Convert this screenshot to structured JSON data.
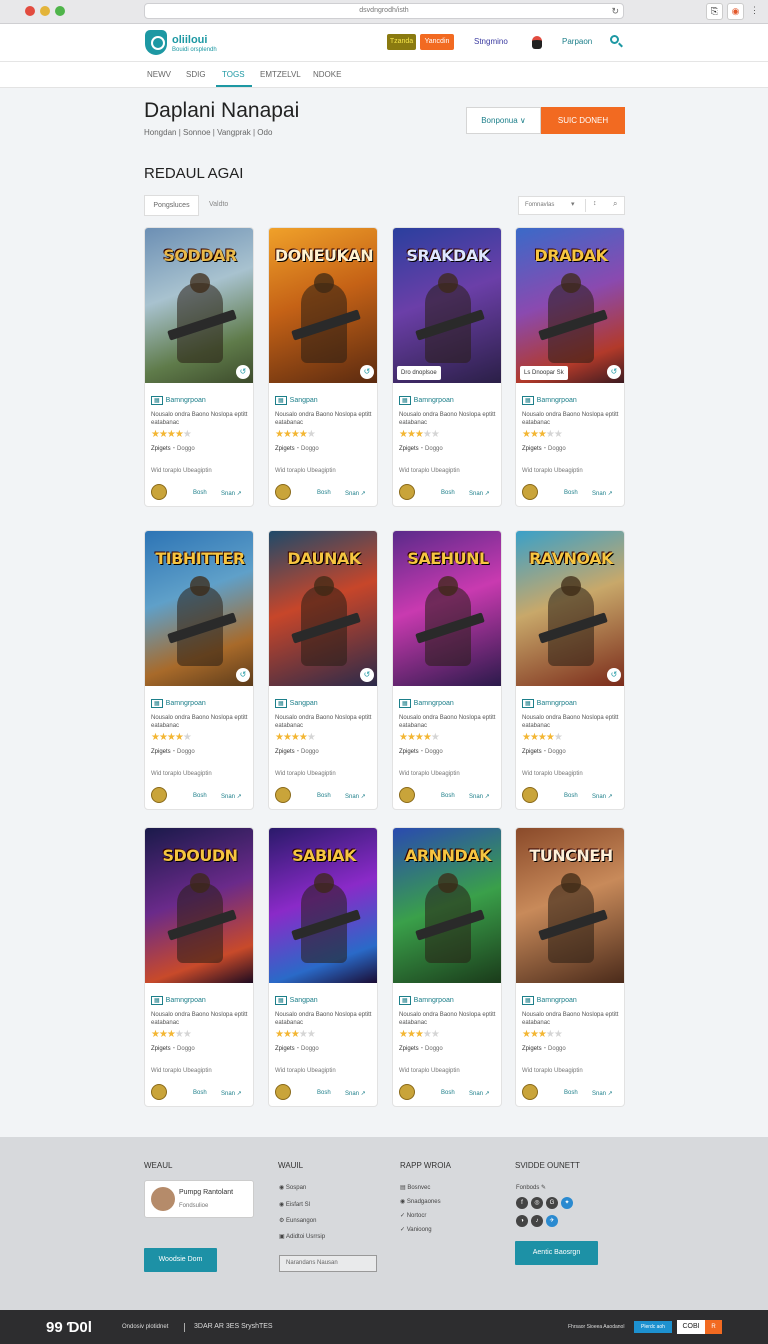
{
  "browser": {
    "url": "dsvdngrodh/isth"
  },
  "header": {
    "logo_title": "oliiloui",
    "logo_sub": "Bouidi orsplendh",
    "btn_a": "Tzanda",
    "btn_b": "Yancdin",
    "link_a": "Stngmino",
    "link_b": "Parpaon"
  },
  "tabs": [
    "NEWV",
    "SDIG",
    "TOGS",
    "EMTZELVL",
    "NDOKE"
  ],
  "page": {
    "title": "Daplani Nanapai",
    "breadcrumb": "Hongdan | Sonnoe | Vangprak | Odo",
    "btn_outline": "Bonponua ∨",
    "btn_primary": "SUIC DONEH",
    "section": "REDAUL AGAI",
    "filter_a": "Pongsluces",
    "filter_b": "Valdto",
    "sort": "Fomnavlas"
  },
  "cards": [
    {
      "title": "SODDAR",
      "caption": "",
      "badge": "↺",
      "tag": "Bamngrpoan",
      "desc": "Nousalo ondra Baono Noslopa eptitt eatabanac",
      "rating": 4,
      "meta": "Zpigets",
      "dl": "Wid toraplo Ubeagiptin",
      "a": "Bosh",
      "b": "Snan ↗",
      "bg": "linear-gradient(160deg,#6c8fb4 0%,#a8c2cf 40%,#5f7b4a 75%,#3c4a2b 100%)",
      "tc": "#e8b84a"
    },
    {
      "title": "DONEUKAN",
      "caption": "",
      "badge": "↺",
      "tag": "Sangpan",
      "desc": "Nousalo ondra Baono Noslopa eptitt eatabanac",
      "rating": 4,
      "meta": "Zpigets",
      "dl": "Wid toraplo Ubeagiptin",
      "a": "Bosh",
      "b": "Snan ↗",
      "bg": "linear-gradient(160deg,#f0a12a 0%,#c56216 45%,#5a2a10 100%)",
      "tc": "#fff2d0"
    },
    {
      "title": "SRAKDAK",
      "caption": "Dro dnoplsoe",
      "badge": "",
      "tag": "Bamngrpoan",
      "desc": "Nousalo ondra Baono Noslopa eptitt eatabanac",
      "rating": 3,
      "meta": "Zpigets",
      "dl": "Wid toraplo Ubeagiptin",
      "a": "Bosh",
      "b": "Snan ↗",
      "bg": "linear-gradient(160deg,#2a3f9e 0%,#6b3fa8 45%,#2a1f46 100%)",
      "tc": "#dfe6ff"
    },
    {
      "title": "DRADAK",
      "caption": "Ls Dnoopar Sk",
      "badge": "↺",
      "tag": "Bamngrpoan",
      "desc": "Nousalo ondra Baono Noslopa eptitt eatabanac",
      "rating": 3,
      "meta": "Zpigets",
      "dl": "Wid toraplo Ubeagiptin",
      "a": "Bosh",
      "b": "Snan ↗",
      "bg": "linear-gradient(160deg,#3a6ac8 0%,#8a4ab0 45%,#b23a2a 80%,#3a1a20 100%)",
      "tc": "#f6c541"
    },
    {
      "title": "TIBHITTER",
      "caption": "",
      "badge": "↺",
      "tag": "Bamngrpoan",
      "desc": "Nousalo ondra Baono Noslopa eptitt eatabanac",
      "rating": 4,
      "meta": "Zpigets",
      "dl": "Wid toraplo Ubeagiptin",
      "a": "Bosh",
      "b": "Snan ↗",
      "bg": "linear-gradient(160deg,#2d74b5 0%,#5fa0c9 40%,#a86a2a 75%,#5a3a1a 100%)",
      "tc": "#f6c541"
    },
    {
      "title": "DAUNAK",
      "caption": "",
      "badge": "↺",
      "tag": "Sangpan",
      "desc": "Nousalo ondra Baono Noslopa eptitt eatabanac",
      "rating": 4,
      "meta": "Zpigets",
      "dl": "Wid toraplo Ubeagiptin",
      "a": "Bosh",
      "b": "Snan ↗",
      "bg": "linear-gradient(160deg,#1f4a6a 0%,#c7462a 45%,#2a2a4a 100%)",
      "tc": "#f6c541"
    },
    {
      "title": "SAEHUNL",
      "caption": "",
      "badge": "",
      "tag": "Bamngrpoan",
      "desc": "Nousalo ondra Baono Noslopa eptitt eatabanac",
      "rating": 4,
      "meta": "Zpigets",
      "dl": "Wid toraplo Ubeagiptin",
      "a": "Bosh",
      "b": "Snan ↗",
      "bg": "linear-gradient(160deg,#5a2a8a 0%,#c93ab0 45%,#2a1a4a 100%)",
      "tc": "#f6c541"
    },
    {
      "title": "RAVNOAK",
      "caption": "",
      "badge": "↺",
      "tag": "Bamngrpoan",
      "desc": "Nousalo ondra Baono Noslopa eptitt eatabanac",
      "rating": 4,
      "meta": "Zpigets",
      "dl": "Wid toraplo Ubeagiptin",
      "a": "Bosh",
      "b": "Snan ↗",
      "bg": "linear-gradient(160deg,#3aa0c8 0%,#c8a86a 45%,#7a2a1a 100%)",
      "tc": "#f6c541"
    },
    {
      "title": "SDOUDN",
      "caption": "",
      "badge": "",
      "tag": "Bamngrpoan",
      "desc": "Nousalo ondra Baono Noslopa eptitt eatabanac",
      "rating": 3,
      "meta": "Zpigets",
      "dl": "Wid toraplo Ubeagiptin",
      "a": "Bosh",
      "b": "Snan ↗",
      "bg": "linear-gradient(160deg,#1a1a4a 0%,#6a2a8a 45%,#c84a2a 80%,#1a0a20 100%)",
      "tc": "#f6c541"
    },
    {
      "title": "SABIAK",
      "caption": "",
      "badge": "",
      "tag": "Sangpan",
      "desc": "Nousalo ondra Baono Noslopa eptitt eatabanac",
      "rating": 3,
      "meta": "Zpigets",
      "dl": "Wid toraplo Ubeagiptin",
      "a": "Bosh",
      "b": "Snan ↗",
      "bg": "linear-gradient(160deg,#2a1a6a 0%,#8a2ac8 45%,#2a6ac8 80%,#1a0a30 100%)",
      "tc": "#f6c541"
    },
    {
      "title": "ARNNDAK",
      "caption": "",
      "badge": "",
      "tag": "Bamngrpoan",
      "desc": "Nousalo ondra Baono Noslopa eptitt eatabanac",
      "rating": 3,
      "meta": "Zpigets",
      "dl": "Wid toraplo Ubeagiptin",
      "a": "Bosh",
      "b": "Snan ↗",
      "bg": "linear-gradient(160deg,#2a4ab0 0%,#3aa04a 50%,#1a3a1a 100%)",
      "tc": "#f6c541"
    },
    {
      "title": "TUNCNEH",
      "caption": "",
      "badge": "",
      "tag": "Bamngrpoan",
      "desc": "Nousalo ondra Baono Noslopa eptitt eatabanac",
      "rating": 3,
      "meta": "Zpigets",
      "dl": "Wid toraplo Ubeagiptin",
      "a": "Bosh",
      "b": "Snan ↗",
      "bg": "linear-gradient(160deg,#8a4a2a 0%,#c88a5a 45%,#4a2a1a 100%)",
      "tc": "#fff0d8"
    }
  ],
  "footer": {
    "col1_head": "WEAUL",
    "profile_name": "Pumpg Rantolant",
    "profile_sub": "Fondsulioe",
    "col1_btn": "Woodsie Dom",
    "col2_head": "WAUIL",
    "col2_items": [
      "Sospan",
      "Eisfart Sl",
      "Eunsangon",
      "Adidtoi Usrrsip"
    ],
    "col2_input": "Narandans Nausan",
    "col3_head": "RAPP WROIA",
    "col3_items": [
      "Bosnvec",
      "Snadgaones",
      "Nortocr",
      "Vanioong"
    ],
    "col4_head": "SVIDDE OUNETT",
    "col4_sub": "Fonbods",
    "col4_btn": "Aentic Baosrgn",
    "bottom_logo": "99 Ɗ0l",
    "bottom_a": "Ondosiv plotidnet",
    "bottom_b": "3DAR AR 3ES SryshTES",
    "bottom_right": "Fhrsaor Sioeea Aaodanol",
    "bottom_pill": "Plerdc aoh",
    "bottom_code": "COBI",
    "bottom_code2": "R"
  },
  "colors": {
    "accent": "#1d98a3",
    "orange": "#f26a21"
  }
}
